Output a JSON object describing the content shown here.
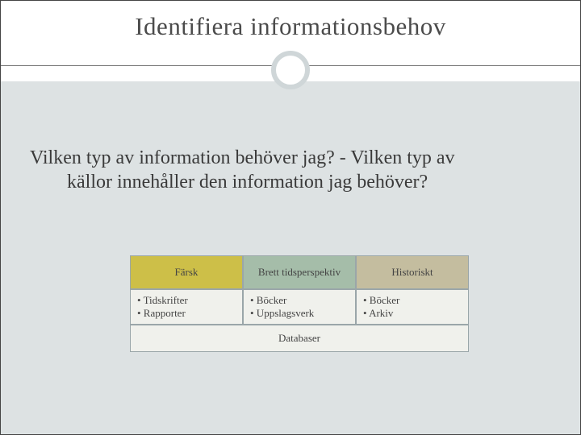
{
  "title": "Identifiera informationsbehov",
  "question": {
    "line1": "Vilken typ av information behöver jag? - Vilken typ av",
    "line2": "källor innehåller den information jag behöver?"
  },
  "table": {
    "headers": [
      "Färsk",
      "Brett tidsperspektiv",
      "Historiskt"
    ],
    "cells": [
      [
        "• Tidskrifter",
        "• Rapporter"
      ],
      [
        "• Böcker",
        "• Uppslagsverk"
      ],
      [
        "• Böcker",
        "• Arkiv"
      ]
    ],
    "footer": "Databaser"
  }
}
